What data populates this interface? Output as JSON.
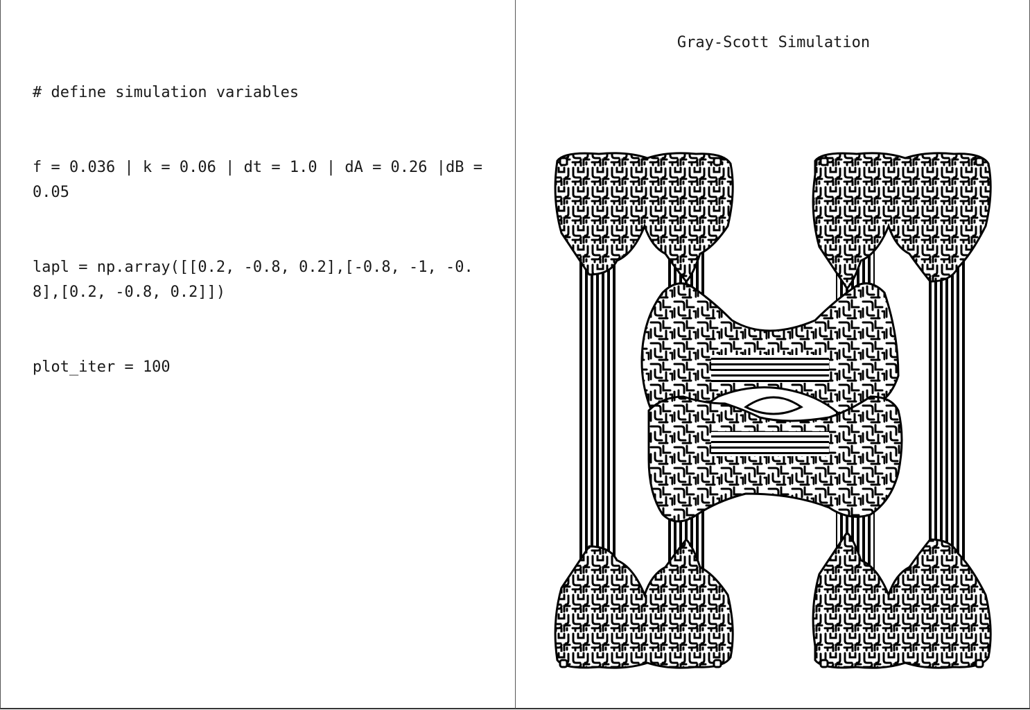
{
  "editor": {
    "lines": [
      "# define simulation variables",
      "f = 0.036 | k = 0.06 | dt = 1.0 | dA = 0.26 |dB = 0.05",
      "lapl = np.array([[0.2, -0.8, 0.2],[-0.8, -1, -0.8],[0.2, -0.8, 0.2]])",
      "plot_iter = 100"
    ]
  },
  "simulation": {
    "title": "Gray-Scott Simulation",
    "pattern_color": "#000000",
    "background_color": "#ffffff"
  }
}
